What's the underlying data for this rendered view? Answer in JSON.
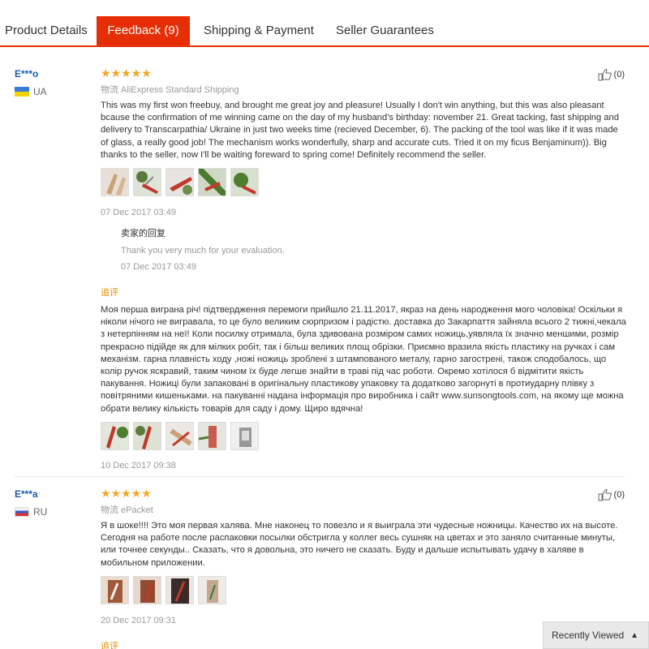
{
  "tabs": [
    {
      "label": "Product Details"
    },
    {
      "label": "Feedback (9)"
    },
    {
      "label": "Shipping & Payment"
    },
    {
      "label": "Seller Guarantees"
    }
  ],
  "reviews": [
    {
      "user": "E***o",
      "country": "UA",
      "stars": "★★★★★",
      "shipping": "物流 AliExpress Standard Shipping",
      "helpful": "(0)",
      "text": "This was my first won freebuy, and brought me great joy and pleasure! Usually I don't win anything, but this was also pleasant bcause the confirmation of me winning came on the day of my husband's birthday: november 21. Great tacking, fast shipping and delivery to Transcarpathia/ Ukraine in just two weeks time (recieved December, 6). The packing of the tool was like if it was made of glass, a really good job! The mechanism works wonderfully, sharp and accurate cuts. Tried it on my ficus Benjaminum)). Big thanks to the seller, now I'll be waiting foreward to spring come! Definitely recommend the seller.",
      "date": "07 Dec 2017 03:49",
      "reply": {
        "title": "卖家的回复",
        "text": "Thank you very much for your evaluation.",
        "date": "07 Dec 2017 03:49"
      },
      "followup": {
        "label": "追评",
        "text": "Моя перша виграна річ! підтвердження перемоги прийшло 21.11.2017, якраз на день народження мого чоловіка! Оскільки я ніколи нічого не вигравала, то це було великим сюрпризом і радістю. доставка до Закарпаття зайняла всього 2 тижні,чекала з нетерпінням на неї! Коли посилку отримала, була здивована розміром самих ножиць,уявляла їх значно меншими, розмір прекрасно підійде як для мілких робіт, так і більш великих площ обрізки. Приємно вразила якість пластику на ручках і сам механізм. гарна плавність ходу ,ножі ножиць зроблені з штампованого металу, гарно загострені, також сподобалось, що колір ручок яскравий, таким чином їх буде легше знайти в траві під час роботи. Окремо хотілося б відмітити якість пакування. Ножиці були запаковані в оригінальну пластикову упаковку та додатково загорнуті в протиударну плівку з повітряними кишеньками. на пакуванні надана інформація про виробника і сайт www.sunsongtools.com, на якому ще можна обрати велику кількість товарів для саду і дому. Щиро вдячна!",
        "date": "10 Dec 2017 09:38"
      }
    },
    {
      "user": "E***a",
      "country": "RU",
      "stars": "★★★★★",
      "shipping": "物流 ePacket",
      "helpful": "(0)",
      "text": "Я в шоке!!!! Это моя первая халява. Мне наконец то повезло и я выиграла эти чудесные ножницы. Качество их на высоте. Сегодня на работе после распаковки посылки обстригла у коллег весь сушняк на цветах и это заняло считанные минуты, или точнее секунды.. Сказать, что я довольна, это ничего не сказать. Буду и дальше испытывать удачу в халяве в мобильном приложении.",
      "date": "20 Dec 2017 09:31",
      "followup": {
        "label": "追评"
      }
    }
  ],
  "recently_viewed": "Recently Viewed",
  "colors": {
    "accent": "#e62e04",
    "star": "#f5a623",
    "link": "#1a5bb3"
  }
}
